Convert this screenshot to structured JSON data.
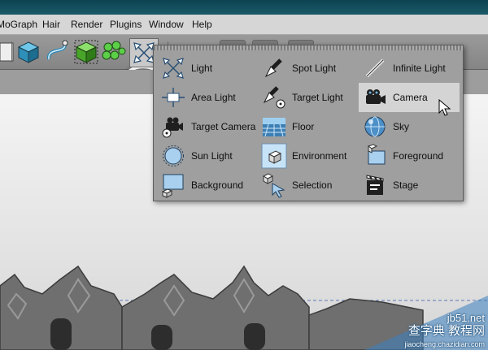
{
  "menubar": {
    "items": [
      "MoGraph",
      "Hair",
      "Render",
      "Plugins",
      "Window",
      "Help"
    ]
  },
  "toolbar": {
    "buttons": [
      "cube-icon",
      "spline-icon",
      "nurbs-icon",
      "array-icon",
      "scene-icon"
    ],
    "active_button": "scene-icon"
  },
  "palette": {
    "items": [
      {
        "label": "Light",
        "icon": "light-icon"
      },
      {
        "label": "Spot Light",
        "icon": "spot-light-icon"
      },
      {
        "label": "Infinite Light",
        "icon": "infinite-light-icon"
      },
      {
        "label": "Area Light",
        "icon": "area-light-icon"
      },
      {
        "label": "Target Light",
        "icon": "target-light-icon"
      },
      {
        "label": "Camera",
        "icon": "camera-icon"
      },
      {
        "label": "Target Camera",
        "icon": "target-camera-icon"
      },
      {
        "label": "Floor",
        "icon": "floor-icon"
      },
      {
        "label": "Sky",
        "icon": "sky-icon"
      },
      {
        "label": "Sun Light",
        "icon": "sun-light-icon"
      },
      {
        "label": "Environment",
        "icon": "environment-icon"
      },
      {
        "label": "Foreground",
        "icon": "foreground-icon"
      },
      {
        "label": "Background",
        "icon": "background-icon"
      },
      {
        "label": "Selection",
        "icon": "selection-icon"
      },
      {
        "label": "Stage",
        "icon": "stage-icon"
      }
    ],
    "hovered_item": "Camera"
  },
  "watermark": {
    "line1": "jb51.net",
    "line2": "查字典 教程网",
    "line3": "jiaocheng.chazidian.com"
  },
  "colors": {
    "palette_bg": "#9f9f9f",
    "hover_bg": "#d4d4d4",
    "toolbar_bg": "#8f8f8f"
  }
}
